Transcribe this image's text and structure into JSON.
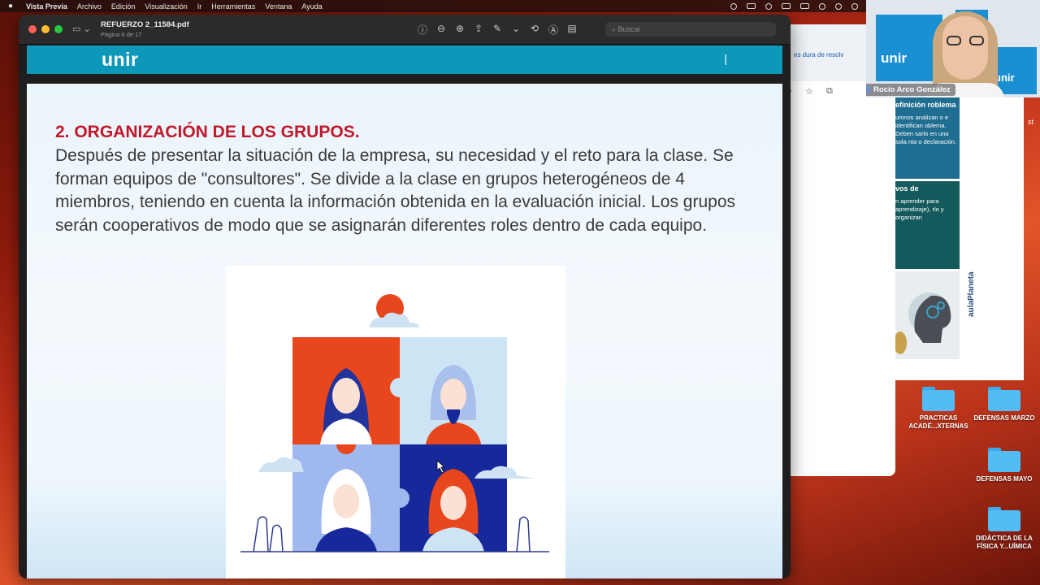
{
  "menubar": {
    "app_name": "Vista Previa",
    "items": [
      "Archivo",
      "Edición",
      "Visualización",
      "Ir",
      "Herramientas",
      "Ventana",
      "Ayuda"
    ]
  },
  "preview_window": {
    "doc_title": "REFUERZO 2_11584.pdf",
    "doc_subtitle": "Página 6 de 17",
    "search_placeholder": "Buscar"
  },
  "slide": {
    "logo": "unir",
    "heading": "2. ORGANIZACIÓN DE LOS GRUPOS",
    "heading_period": ".",
    "body": "Después de presentar la situación de la empresa, su necesidad y el reto para la clase. Se forman equipos de \"consultores\". Se divide a la clase en grupos heterogéneos de 4 miembros, teniendo en cuenta la información obtenida en la evaluación inicial. Los grupos serán cooperativos de modo que se asignarán diferentes roles dentro de cada equipo."
  },
  "webcam": {
    "participant_name": "Rocío Arco González",
    "logo_text": "unir"
  },
  "browser": {
    "link_fragment": "es dura de resolv",
    "cards": [
      {
        "title": "efinición roblema",
        "text": "umnos analizan o e identifican oblema. Deben sarlo en una sola nta o declaración."
      },
      {
        "title": "vos de",
        "text": "n aprender para aprendizaje), rlo y organizan"
      },
      {
        "title": "",
        "text": ""
      }
    ],
    "brand": "aulaPlaneta",
    "edge_text": "st"
  },
  "desktop_icons": [
    {
      "label": "PRACTICAS ACADÉ...XTERNAS"
    },
    {
      "label": "DEFENSAS MARZO"
    },
    {
      "label": "DEFENSAS MAYO"
    },
    {
      "label": "DIDÁCTICA DE LA FÍSICA Y...UÍMICA"
    }
  ],
  "colors": {
    "heading_red": "#c0192a",
    "header_blue": "#0d98ba",
    "folder_blue": "#52bdf5"
  }
}
